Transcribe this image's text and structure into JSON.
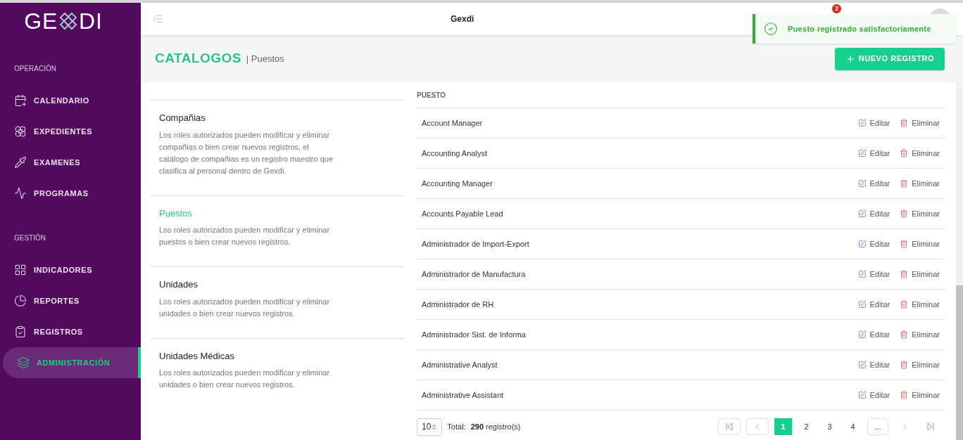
{
  "logo": {
    "left": "GE",
    "right": "DI"
  },
  "sidebar": {
    "sections": [
      {
        "title": "OPERACIÓN",
        "items": [
          {
            "label": "CALENDARIO",
            "selected": false
          },
          {
            "label": "EXPEDIENTES",
            "selected": false
          },
          {
            "label": "EXAMENES",
            "selected": false
          },
          {
            "label": "PROGRAMAS",
            "selected": false
          }
        ]
      },
      {
        "title": "GESTIÓN",
        "items": [
          {
            "label": "INDICADORES",
            "selected": false
          },
          {
            "label": "REPORTES",
            "selected": false
          },
          {
            "label": "REGISTROS",
            "selected": false
          },
          {
            "label": "ADMINISTRACIÓN",
            "selected": true
          }
        ]
      }
    ]
  },
  "header": {
    "title": "Gexdi",
    "notification_count": "2"
  },
  "toast": {
    "message": "Puesto registrado satisfactoriamente"
  },
  "page": {
    "title": "CATALOGOS",
    "subtitle": "| Puestos",
    "new_button": "NUEVO REGISTRO"
  },
  "catalogs": [
    {
      "title": "Compañias",
      "description": "Los roles autorizados pueden modificar y eliminar compañias o bien crear nuevos registros, el catálogo de compañias es un registro maestro que clasifica al personal dentro de Gexdi.",
      "selected": false
    },
    {
      "title": "Puestos",
      "description": "Los roles autorizados pueden modificar y eliminar puestos o bien crear nuevos registros.",
      "selected": true
    },
    {
      "title": "Unidades",
      "description": "Los roles autorizados pueden modificar y eliminar unidades o bien crear nuevos registros.",
      "selected": false
    },
    {
      "title": "Unidades Médicas",
      "description": "Los roles autorizados pueden modificar y eliminar unidades o bien crear nuevos registros.",
      "selected": false
    }
  ],
  "table": {
    "columns": [
      "PUESTO"
    ],
    "rows": [
      {
        "name": "Account Manager",
        "edit": "Editar",
        "delete": "Eliminar"
      },
      {
        "name": "Accounting Analyst",
        "edit": "Editar",
        "delete": "Eliminar"
      },
      {
        "name": "Accounting Manager",
        "edit": "Editar",
        "delete": "Eliminar"
      },
      {
        "name": "Accounts Payable Lead",
        "edit": "Editar",
        "delete": "Eliminar"
      },
      {
        "name": "Administrador de Import-Export",
        "edit": "Editar",
        "delete": "Eliminar"
      },
      {
        "name": "Administrador de Manufactura",
        "edit": "Editar",
        "delete": "Eliminar"
      },
      {
        "name": "Administrador de RH",
        "edit": "Editar",
        "delete": "Eliminar"
      },
      {
        "name": "Administrador Sist. de Informa",
        "edit": "Editar",
        "delete": "Eliminar"
      },
      {
        "name": "Administrative Analyst",
        "edit": "Editar",
        "delete": "Eliminar"
      },
      {
        "name": "Administrative Assistant",
        "edit": "Editar",
        "delete": "Eliminar"
      }
    ]
  },
  "footer": {
    "page_size": "10",
    "total_label": "Total:",
    "total": "290",
    "total_unit": "registro(s)",
    "pages": [
      {
        "label": "1",
        "selected": true
      },
      {
        "label": "2",
        "selected": false
      },
      {
        "label": "3",
        "selected": false
      },
      {
        "label": "4",
        "selected": false
      }
    ],
    "more": "..."
  }
}
